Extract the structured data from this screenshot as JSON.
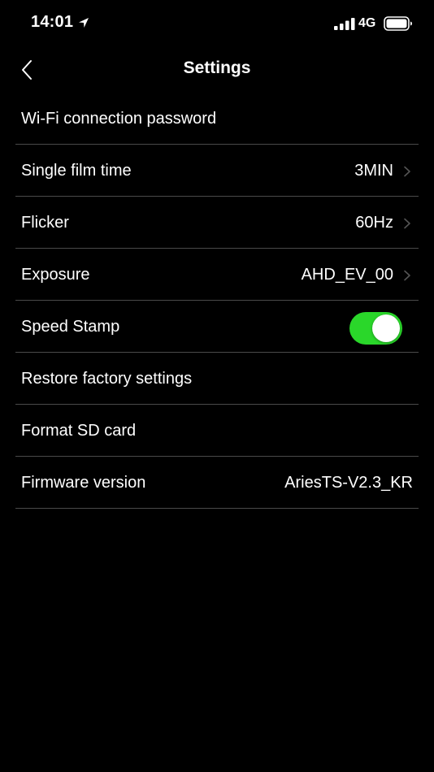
{
  "status_bar": {
    "time": "14:01",
    "network": "4G",
    "icons": [
      "location-arrow-icon",
      "signal-bars-icon",
      "battery-icon"
    ]
  },
  "nav": {
    "title": "Settings",
    "back_icon": "chevron-left-icon"
  },
  "settings": {
    "wifi_password": {
      "label": "Wi-Fi connection password"
    },
    "single_film_time": {
      "label": "Single film time",
      "value": "3MIN"
    },
    "flicker": {
      "label": "Flicker",
      "value": "60Hz"
    },
    "exposure": {
      "label": "Exposure",
      "value": "AHD_EV_00"
    },
    "speed_stamp": {
      "label": "Speed Stamp",
      "enabled": true
    },
    "restore_factory": {
      "label": "Restore factory settings"
    },
    "format_sd": {
      "label": "Format SD card"
    },
    "firmware_version": {
      "label": "Firmware version",
      "value": "AriesTS-V2.3_KR"
    }
  },
  "colors": {
    "background": "#000000",
    "text": "#ffffff",
    "divider": "#4a4a4a",
    "toggle_on": "#2ad72a",
    "chevron": "#555555"
  }
}
